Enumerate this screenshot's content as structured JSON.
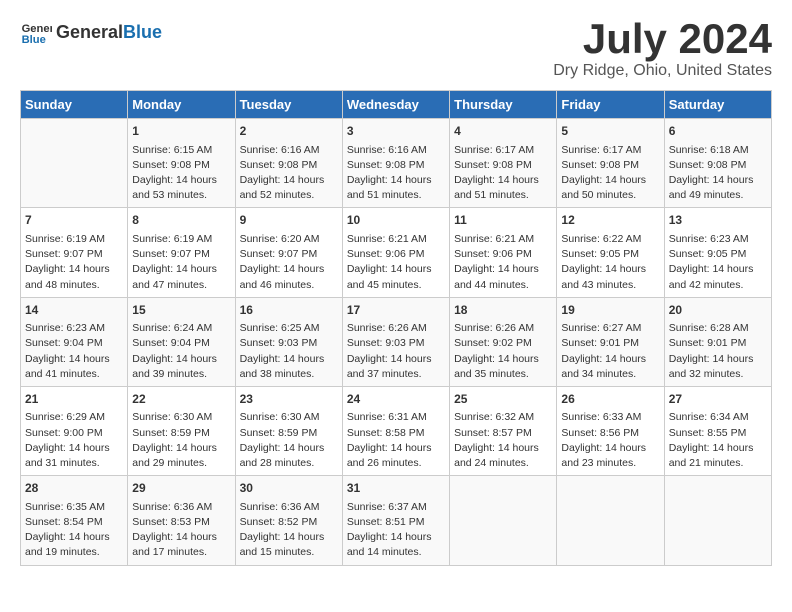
{
  "logo": {
    "general": "General",
    "blue": "Blue"
  },
  "title": "July 2024",
  "subtitle": "Dry Ridge, Ohio, United States",
  "days_of_week": [
    "Sunday",
    "Monday",
    "Tuesday",
    "Wednesday",
    "Thursday",
    "Friday",
    "Saturday"
  ],
  "weeks": [
    [
      {
        "day": "",
        "content": ""
      },
      {
        "day": "1",
        "content": "Sunrise: 6:15 AM\nSunset: 9:08 PM\nDaylight: 14 hours\nand 53 minutes."
      },
      {
        "day": "2",
        "content": "Sunrise: 6:16 AM\nSunset: 9:08 PM\nDaylight: 14 hours\nand 52 minutes."
      },
      {
        "day": "3",
        "content": "Sunrise: 6:16 AM\nSunset: 9:08 PM\nDaylight: 14 hours\nand 51 minutes."
      },
      {
        "day": "4",
        "content": "Sunrise: 6:17 AM\nSunset: 9:08 PM\nDaylight: 14 hours\nand 51 minutes."
      },
      {
        "day": "5",
        "content": "Sunrise: 6:17 AM\nSunset: 9:08 PM\nDaylight: 14 hours\nand 50 minutes."
      },
      {
        "day": "6",
        "content": "Sunrise: 6:18 AM\nSunset: 9:08 PM\nDaylight: 14 hours\nand 49 minutes."
      }
    ],
    [
      {
        "day": "7",
        "content": "Sunrise: 6:19 AM\nSunset: 9:07 PM\nDaylight: 14 hours\nand 48 minutes."
      },
      {
        "day": "8",
        "content": "Sunrise: 6:19 AM\nSunset: 9:07 PM\nDaylight: 14 hours\nand 47 minutes."
      },
      {
        "day": "9",
        "content": "Sunrise: 6:20 AM\nSunset: 9:07 PM\nDaylight: 14 hours\nand 46 minutes."
      },
      {
        "day": "10",
        "content": "Sunrise: 6:21 AM\nSunset: 9:06 PM\nDaylight: 14 hours\nand 45 minutes."
      },
      {
        "day": "11",
        "content": "Sunrise: 6:21 AM\nSunset: 9:06 PM\nDaylight: 14 hours\nand 44 minutes."
      },
      {
        "day": "12",
        "content": "Sunrise: 6:22 AM\nSunset: 9:05 PM\nDaylight: 14 hours\nand 43 minutes."
      },
      {
        "day": "13",
        "content": "Sunrise: 6:23 AM\nSunset: 9:05 PM\nDaylight: 14 hours\nand 42 minutes."
      }
    ],
    [
      {
        "day": "14",
        "content": "Sunrise: 6:23 AM\nSunset: 9:04 PM\nDaylight: 14 hours\nand 41 minutes."
      },
      {
        "day": "15",
        "content": "Sunrise: 6:24 AM\nSunset: 9:04 PM\nDaylight: 14 hours\nand 39 minutes."
      },
      {
        "day": "16",
        "content": "Sunrise: 6:25 AM\nSunset: 9:03 PM\nDaylight: 14 hours\nand 38 minutes."
      },
      {
        "day": "17",
        "content": "Sunrise: 6:26 AM\nSunset: 9:03 PM\nDaylight: 14 hours\nand 37 minutes."
      },
      {
        "day": "18",
        "content": "Sunrise: 6:26 AM\nSunset: 9:02 PM\nDaylight: 14 hours\nand 35 minutes."
      },
      {
        "day": "19",
        "content": "Sunrise: 6:27 AM\nSunset: 9:01 PM\nDaylight: 14 hours\nand 34 minutes."
      },
      {
        "day": "20",
        "content": "Sunrise: 6:28 AM\nSunset: 9:01 PM\nDaylight: 14 hours\nand 32 minutes."
      }
    ],
    [
      {
        "day": "21",
        "content": "Sunrise: 6:29 AM\nSunset: 9:00 PM\nDaylight: 14 hours\nand 31 minutes."
      },
      {
        "day": "22",
        "content": "Sunrise: 6:30 AM\nSunset: 8:59 PM\nDaylight: 14 hours\nand 29 minutes."
      },
      {
        "day": "23",
        "content": "Sunrise: 6:30 AM\nSunset: 8:59 PM\nDaylight: 14 hours\nand 28 minutes."
      },
      {
        "day": "24",
        "content": "Sunrise: 6:31 AM\nSunset: 8:58 PM\nDaylight: 14 hours\nand 26 minutes."
      },
      {
        "day": "25",
        "content": "Sunrise: 6:32 AM\nSunset: 8:57 PM\nDaylight: 14 hours\nand 24 minutes."
      },
      {
        "day": "26",
        "content": "Sunrise: 6:33 AM\nSunset: 8:56 PM\nDaylight: 14 hours\nand 23 minutes."
      },
      {
        "day": "27",
        "content": "Sunrise: 6:34 AM\nSunset: 8:55 PM\nDaylight: 14 hours\nand 21 minutes."
      }
    ],
    [
      {
        "day": "28",
        "content": "Sunrise: 6:35 AM\nSunset: 8:54 PM\nDaylight: 14 hours\nand 19 minutes."
      },
      {
        "day": "29",
        "content": "Sunrise: 6:36 AM\nSunset: 8:53 PM\nDaylight: 14 hours\nand 17 minutes."
      },
      {
        "day": "30",
        "content": "Sunrise: 6:36 AM\nSunset: 8:52 PM\nDaylight: 14 hours\nand 15 minutes."
      },
      {
        "day": "31",
        "content": "Sunrise: 6:37 AM\nSunset: 8:51 PM\nDaylight: 14 hours\nand 14 minutes."
      },
      {
        "day": "",
        "content": ""
      },
      {
        "day": "",
        "content": ""
      },
      {
        "day": "",
        "content": ""
      }
    ]
  ]
}
